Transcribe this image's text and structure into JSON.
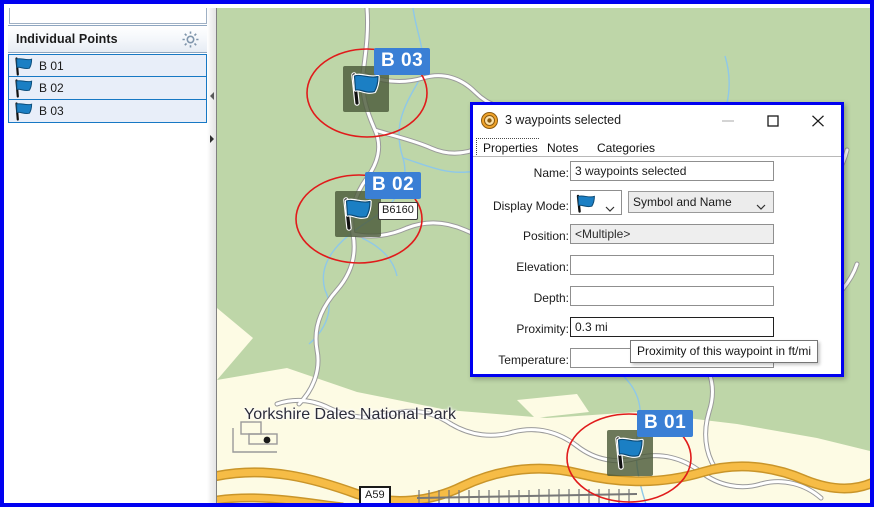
{
  "window": {
    "accent_border_color": "#0000f0"
  },
  "sidebar": {
    "search_value": "",
    "header": {
      "title": "Individual Points",
      "settings_icon": "gear-icon"
    },
    "items": [
      {
        "label": "B 01",
        "icon": "blue-flag-icon",
        "selected": true
      },
      {
        "label": "B 02",
        "icon": "blue-flag-icon",
        "selected": true
      },
      {
        "label": "B 03",
        "icon": "blue-flag-icon",
        "selected": true
      }
    ]
  },
  "splitter": {
    "collapse_icon": "triangle-left-icon",
    "expand_icon": "triangle-right-icon"
  },
  "map": {
    "area_label": "Yorkshire Dales National Park",
    "road_shields": [
      {
        "name": "A59"
      },
      {
        "name": "B6160"
      }
    ],
    "waypoints": [
      {
        "label": "B 03",
        "icon": "blue-flag-marker",
        "proximity_circle": true
      },
      {
        "label": "B 02",
        "icon": "blue-flag-marker",
        "proximity_circle": true
      },
      {
        "label": "B 01",
        "icon": "blue-flag-marker",
        "proximity_circle": true
      }
    ],
    "colors": {
      "park_green": "#bed6a8",
      "land_cream": "#fdfbe4",
      "major_road": "#f6bc46",
      "minor_road": "#ffffff",
      "water": "#8fc8e8",
      "proximity_circle": "#e01b1b"
    }
  },
  "dialog": {
    "title": "3 waypoints selected",
    "app_icon": "waypoint-icon",
    "buttons": {
      "minimize": "—",
      "maximize": "☐",
      "close": "✕"
    },
    "tabs": [
      {
        "label": "Properties",
        "active": true
      },
      {
        "label": "Notes",
        "active": false
      },
      {
        "label": "Categories",
        "active": false
      }
    ],
    "fields": [
      {
        "label": "Name:",
        "value": "3 waypoints selected",
        "readonly": false,
        "focused": false
      },
      {
        "label": "Display Mode:",
        "value": "Symbol and Name",
        "symbol_icon": "blue-flag-icon",
        "readonly": false,
        "focused": false
      },
      {
        "label": "Position:",
        "value": "<Multiple>",
        "readonly": true,
        "focused": false
      },
      {
        "label": "Elevation:",
        "value": "",
        "readonly": false,
        "focused": false
      },
      {
        "label": "Depth:",
        "value": "",
        "readonly": false,
        "focused": false
      },
      {
        "label": "Proximity:",
        "value": "0.3 mi",
        "readonly": false,
        "focused": true
      },
      {
        "label": "Temperature:",
        "value": "",
        "readonly": false,
        "focused": false
      }
    ]
  },
  "tooltip": {
    "text": "Proximity of this waypoint in ft/mi"
  }
}
